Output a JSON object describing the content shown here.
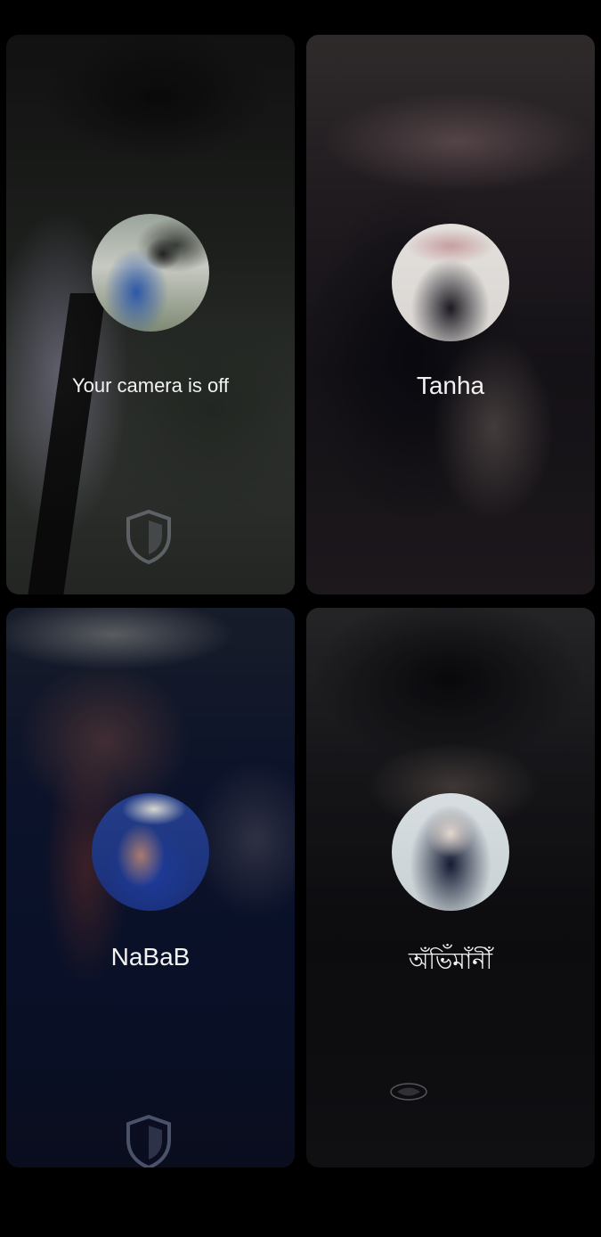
{
  "tiles": [
    {
      "id": "self",
      "label": "Your camera is off",
      "icon": "shield-icon"
    },
    {
      "id": "participant-1",
      "label": "Tanha"
    },
    {
      "id": "participant-2",
      "label": "NaBaB",
      "icon": "shield-icon"
    },
    {
      "id": "participant-3",
      "label": "অঁভিঁমাঁনীঁ"
    }
  ],
  "colors": {
    "background": "#000000",
    "label_text": "#f2f2f2"
  }
}
